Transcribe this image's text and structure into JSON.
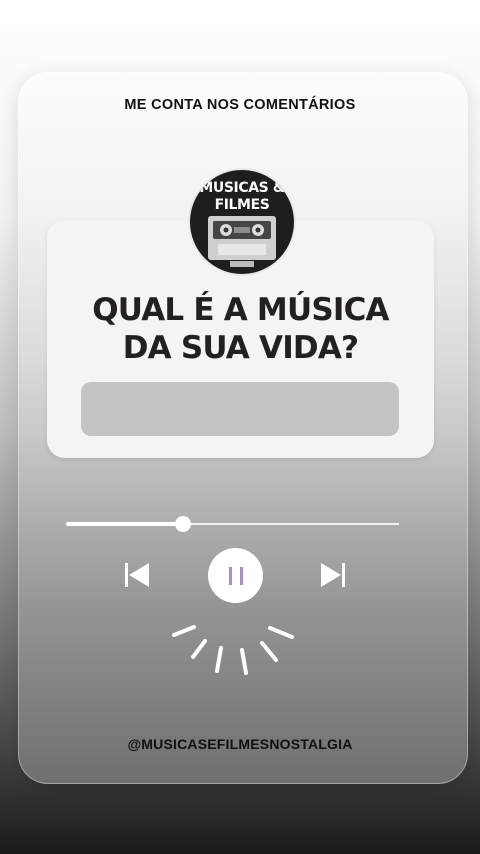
{
  "header": {
    "title": "ME CONTA NOS COMENTÁRIOS"
  },
  "avatar": {
    "title_line1": "MUSICAS &",
    "title_line2": "FILMES",
    "icon": "cassette-tape-icon"
  },
  "question": {
    "line1": "QUAL É A MÚSICA",
    "line2": "DA SUA VIDA?"
  },
  "answer": {
    "value": "",
    "placeholder": ""
  },
  "player": {
    "progress": 0.35,
    "prev_icon": "skip-back-icon",
    "pause_icon": "pause-icon",
    "next_icon": "skip-forward-icon",
    "accent": "#a88fc0",
    "burst_icon": "sparkle-burst-icon"
  },
  "footer": {
    "handle": "@MUSICASEFILMESNOSTALGIA"
  }
}
